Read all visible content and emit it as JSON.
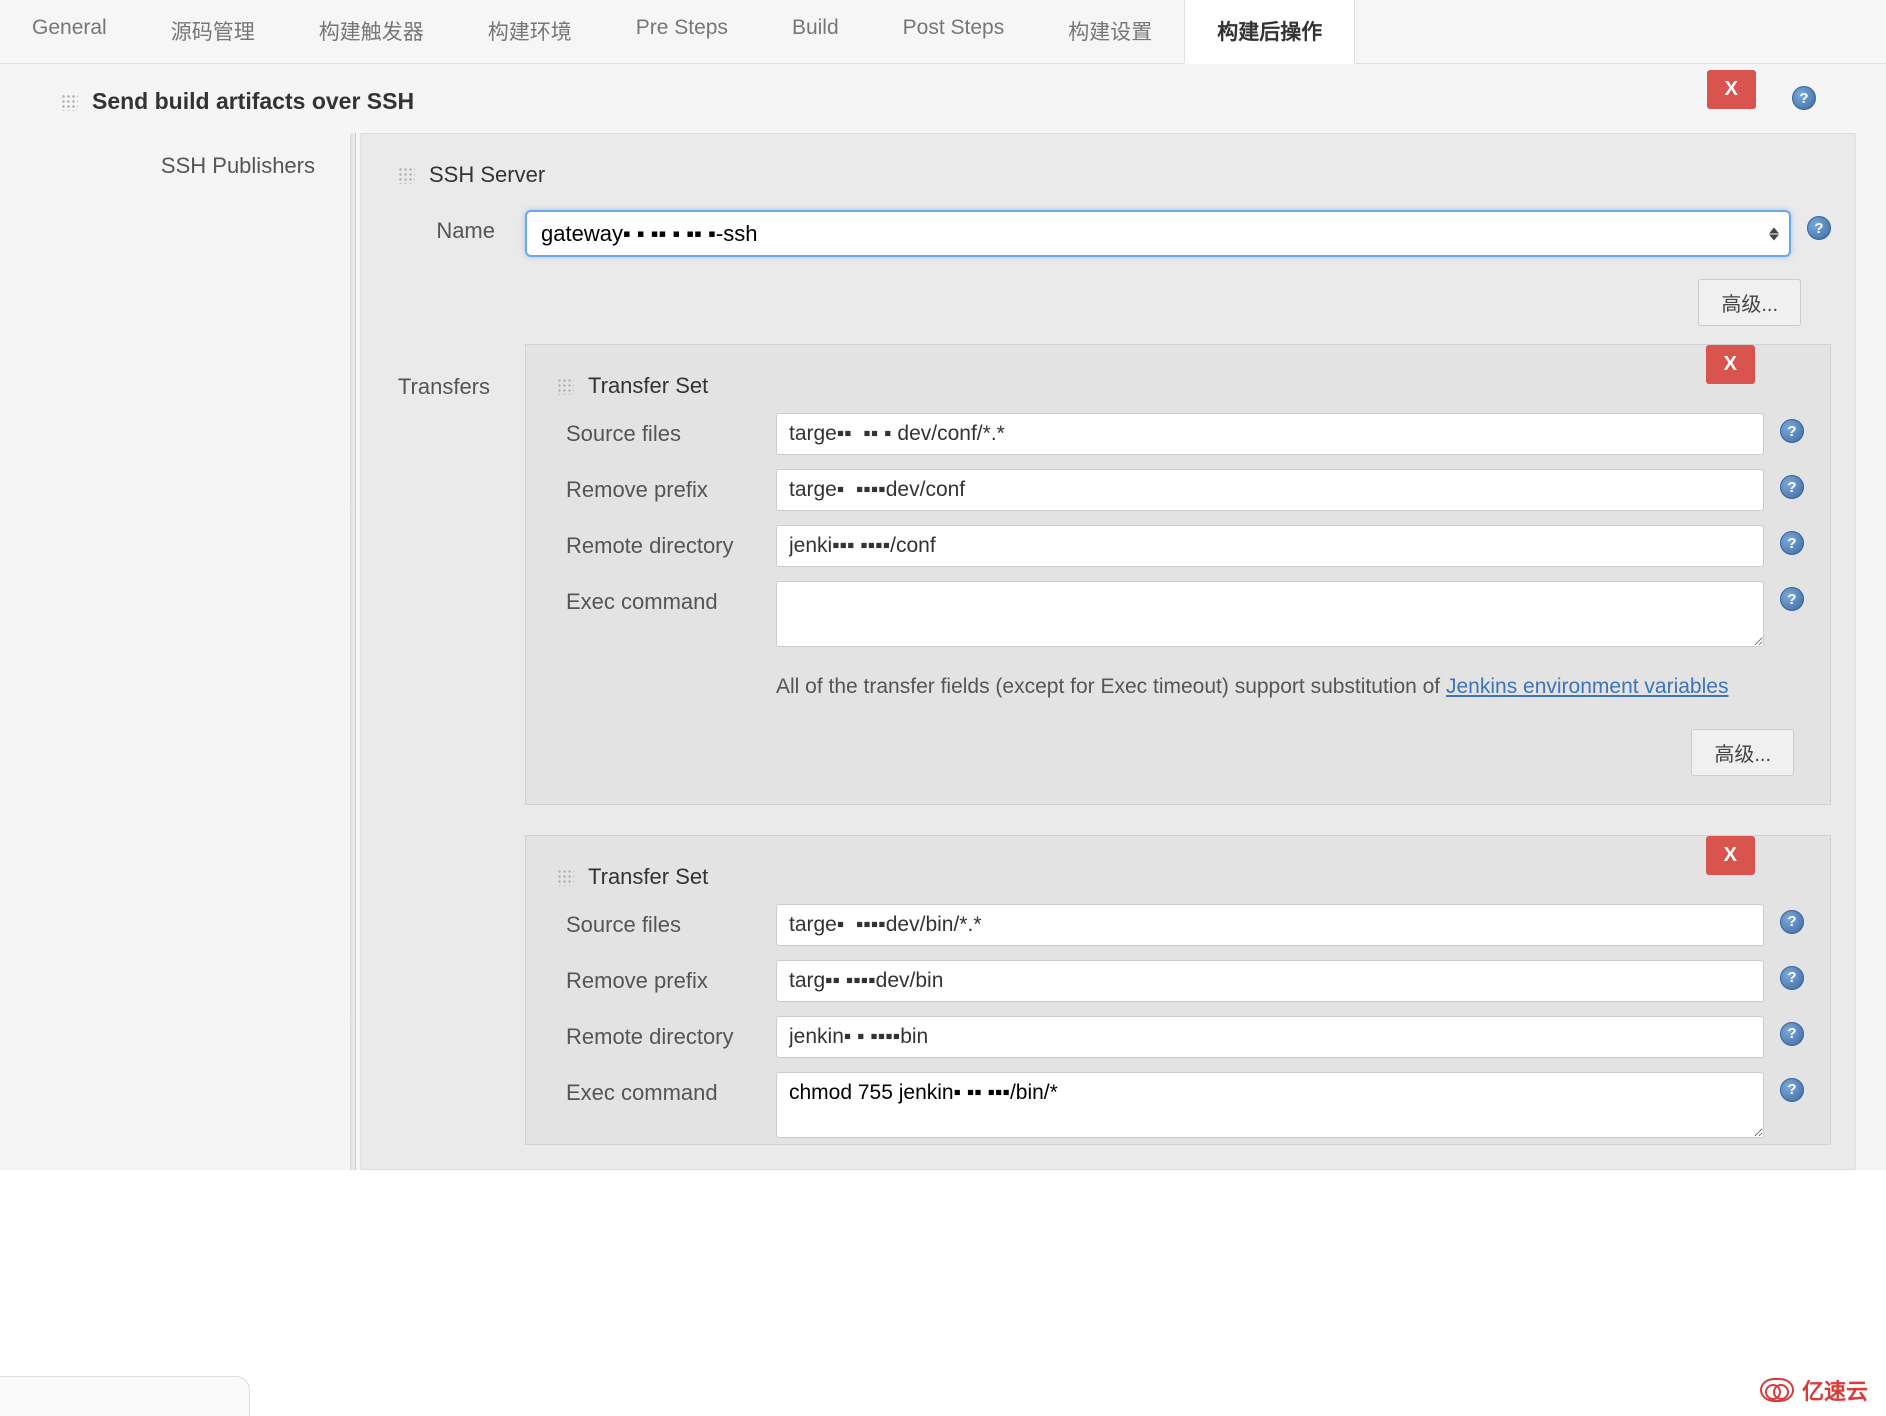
{
  "tabs": {
    "general": "General",
    "scm": "源码管理",
    "triggers": "构建触发器",
    "env": "构建环境",
    "presteps": "Pre Steps",
    "build": "Build",
    "poststeps": "Post Steps",
    "buildsettings": "构建设置",
    "postbuild": "构建后操作"
  },
  "section_title": "Send build artifacts over SSH",
  "delete_x": "X",
  "ssh_publishers_label": "SSH Publishers",
  "ssh_server": {
    "header": "SSH Server",
    "name_label": "Name",
    "name_value": "gateway▪  ▪ ▪▪ ▪ ▪▪ ▪-ssh",
    "advanced": "高级..."
  },
  "transfers_label": "Transfers",
  "transfer_set_header": "Transfer Set",
  "fields": {
    "source_files": "Source files",
    "remove_prefix": "Remove prefix",
    "remote_dir": "Remote directory",
    "exec_cmd": "Exec command"
  },
  "transfer1": {
    "source_files": "targe▪▪  ▪▪ ▪ dev/conf/*.*",
    "remove_prefix": "targe▪  ▪▪▪▪dev/conf",
    "remote_dir": "jenki▪▪▪ ▪▪▪▪/conf",
    "exec_cmd": "",
    "note_pre": "All of the transfer fields (except for Exec timeout) support substitution of ",
    "note_link": "Jenkins environment variables",
    "advanced": "高级..."
  },
  "transfer2": {
    "source_files": "targe▪  ▪▪▪▪dev/bin/*.*",
    "remove_prefix": "targ▪▪ ▪▪▪▪dev/bin",
    "remote_dir": "jenkin▪ ▪ ▪▪▪▪bin",
    "exec_cmd": "chmod 755 jenkin▪ ▪▪ ▪▪▪/bin/*"
  },
  "watermark": "亿速云"
}
